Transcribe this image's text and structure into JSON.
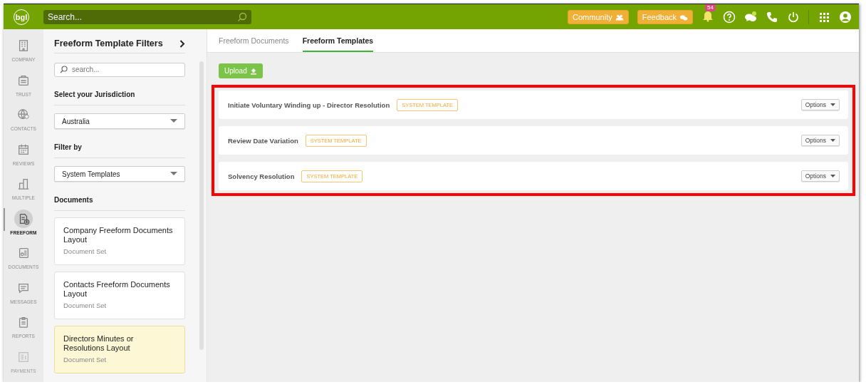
{
  "topbar": {
    "logo": "bgl",
    "search": {
      "placeholder": "Search..."
    },
    "buttons": [
      {
        "label": "Community",
        "kind": "community"
      },
      {
        "label": "Feedback",
        "kind": "feedback"
      }
    ],
    "notifications": {
      "count": "54"
    }
  },
  "nav": [
    {
      "label": "COMPANY",
      "kind": "company",
      "selected": false,
      "disabled": false
    },
    {
      "label": "TRUST",
      "kind": "trust",
      "selected": false,
      "disabled": false
    },
    {
      "label": "CONTACTS",
      "kind": "contacts",
      "selected": false,
      "disabled": false
    },
    {
      "label": "REVIEWS",
      "kind": "reviews",
      "selected": false,
      "disabled": false
    },
    {
      "label": "MULTIPLE",
      "kind": "multiple",
      "selected": false,
      "disabled": false
    },
    {
      "label": "FREEFORM",
      "kind": "freeform",
      "selected": true,
      "disabled": false
    },
    {
      "label": "DOCUMENTS",
      "kind": "documents",
      "selected": false,
      "disabled": false
    },
    {
      "label": "MESSAGES",
      "kind": "messages",
      "selected": false,
      "disabled": false
    },
    {
      "label": "REPORTS",
      "kind": "reports",
      "selected": false,
      "disabled": false
    },
    {
      "label": "PAYMENTS",
      "kind": "payments",
      "selected": false,
      "disabled": true
    }
  ],
  "filters": {
    "title": "Freeform Template Filters",
    "search": {
      "placeholder": "search..."
    },
    "jurisdiction": {
      "label": "Select your Jurisdiction",
      "value": "Australia"
    },
    "filter_by": {
      "label": "Filter by",
      "value": "System Templates"
    },
    "documents_label": "Documents",
    "documents": [
      {
        "title": "Company Freeform Documents Layout",
        "subtitle": "Document Set",
        "selected": false
      },
      {
        "title": "Contacts Freeform Documents Layout",
        "subtitle": "Document Set",
        "selected": false
      },
      {
        "title": "Directors Minutes or Resolutions Layout",
        "subtitle": "Document Set",
        "selected": true
      }
    ]
  },
  "tabs": [
    {
      "label": "Freeform Documents",
      "selected": false
    },
    {
      "label": "Freeform Templates",
      "selected": true
    }
  ],
  "upload_button": "Upload",
  "templates": {
    "highlighted": true,
    "rows": [
      {
        "name": "Initiate Voluntary Winding up - Director Resolution",
        "tag": "SYSTEM TEMPLATE",
        "action": "Options"
      },
      {
        "name": "Review Date Variation",
        "tag": "SYSTEM TEMPLATE",
        "action": "Options"
      },
      {
        "name": "Solvency Resolution",
        "tag": "SYSTEM TEMPLATE",
        "action": "Options"
      }
    ]
  }
}
